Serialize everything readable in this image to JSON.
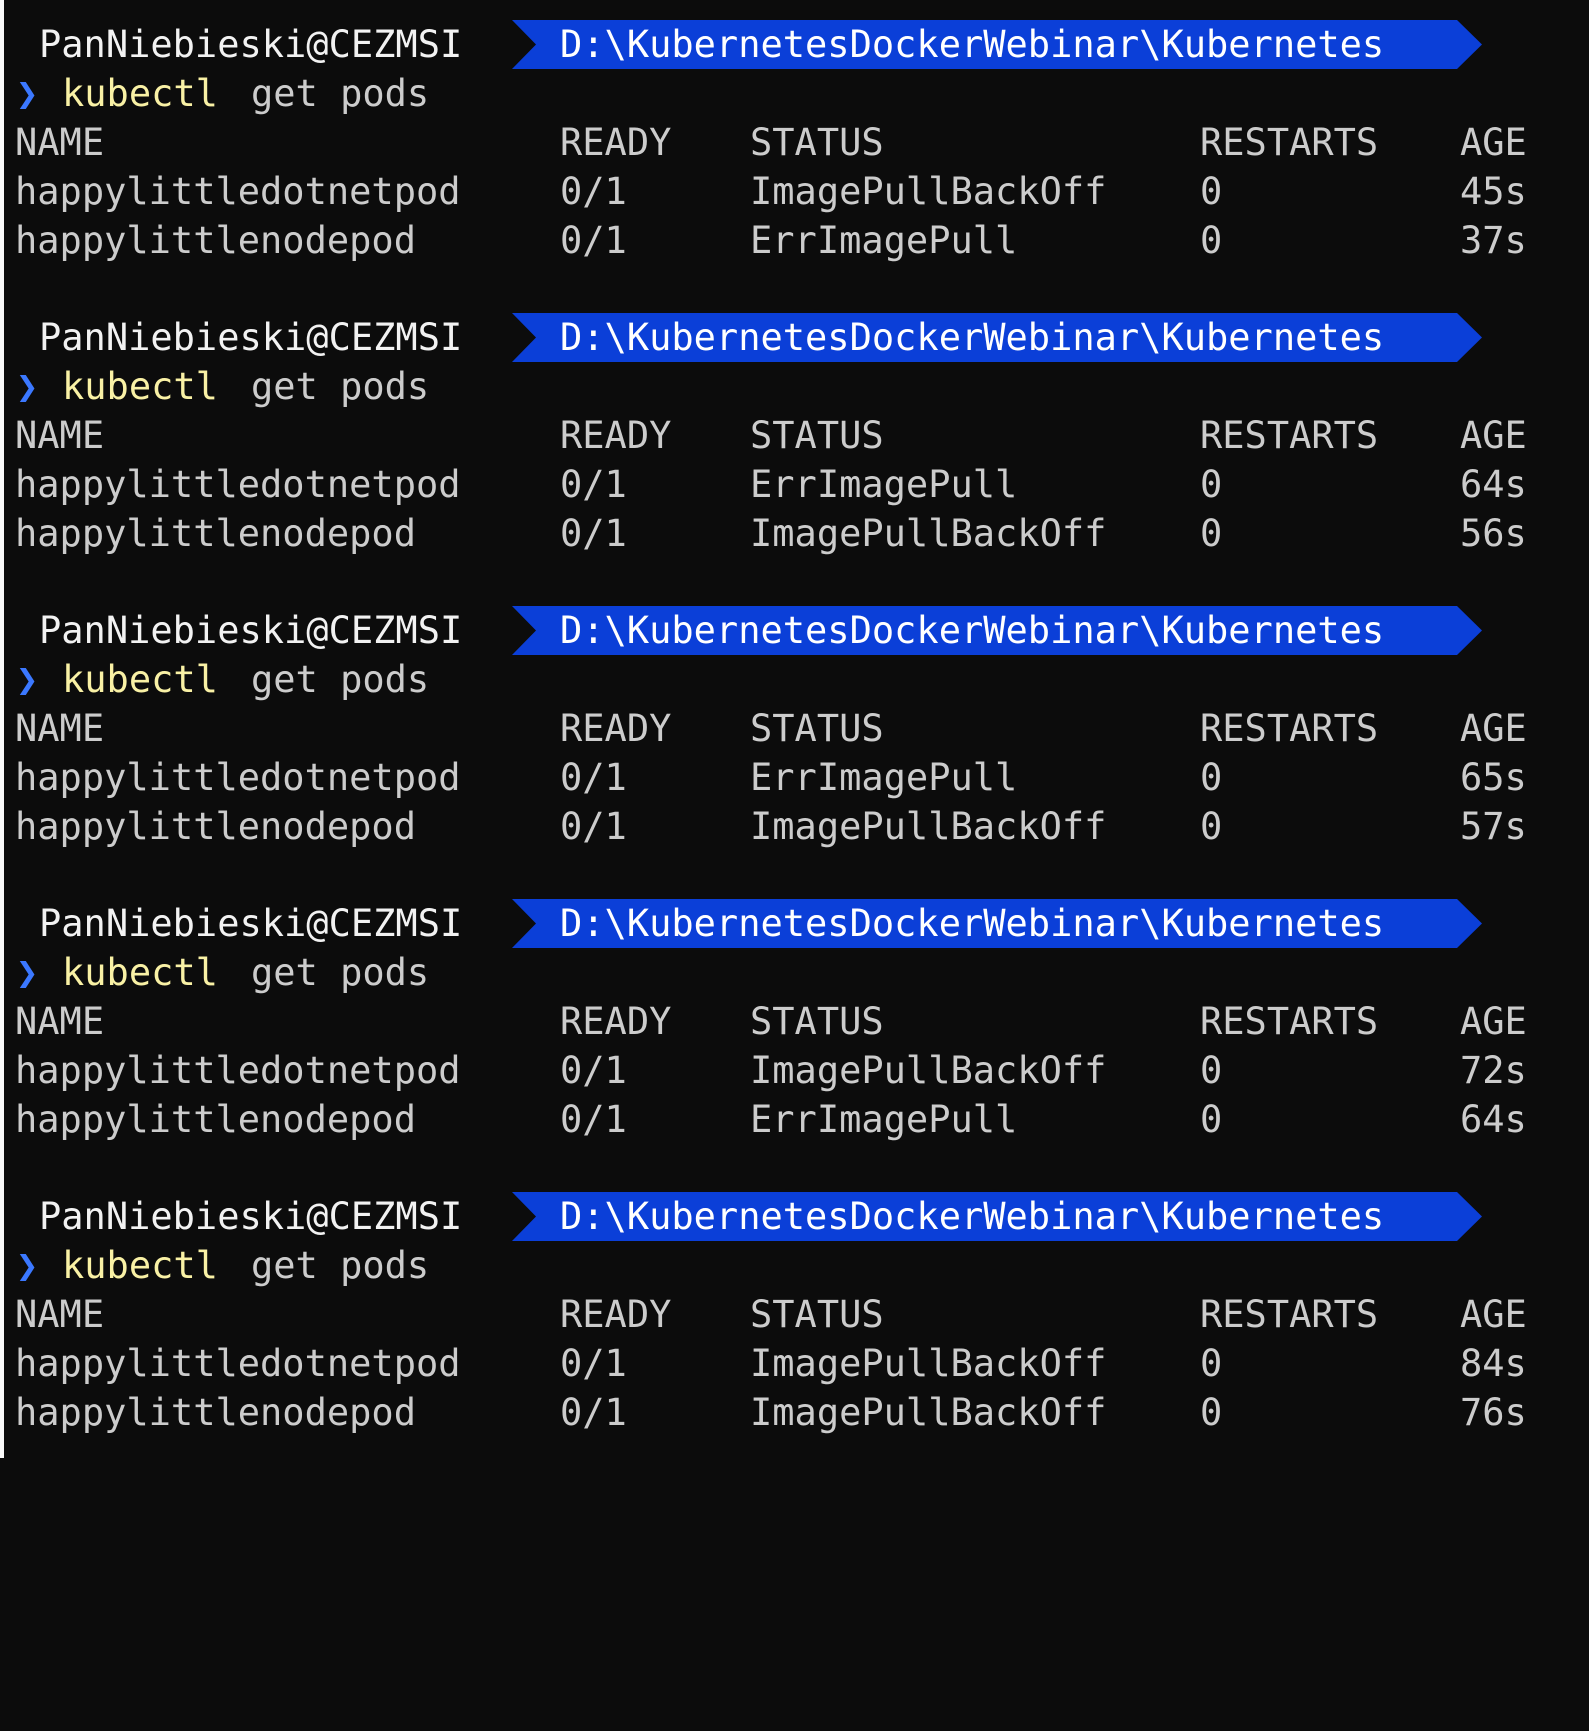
{
  "colors": {
    "background": "#0c0c0c",
    "text": "#cccccc",
    "path_segment": "#0b3fd8",
    "prompt_chevron": "#3b78ff",
    "command": "#f9f1a5"
  },
  "icons": {
    "prompt": "chevron-right-icon"
  },
  "prompt_chevron": "❯",
  "blocks": [
    {
      "user": "PanNiebieski@CEZMSI",
      "path": "D:\\KubernetesDockerWebinar\\Kubernetes",
      "command": "kubectl",
      "args": "get pods",
      "headers": [
        "NAME",
        "READY",
        "STATUS",
        "RESTARTS",
        "AGE"
      ],
      "rows": [
        [
          "happylittledotnetpod",
          "0/1",
          "ImagePullBackOff",
          "0",
          "45s"
        ],
        [
          "happylittlenodepod",
          "0/1",
          "ErrImagePull",
          "0",
          "37s"
        ]
      ]
    },
    {
      "user": "PanNiebieski@CEZMSI",
      "path": "D:\\KubernetesDockerWebinar\\Kubernetes",
      "command": "kubectl",
      "args": "get pods",
      "headers": [
        "NAME",
        "READY",
        "STATUS",
        "RESTARTS",
        "AGE"
      ],
      "rows": [
        [
          "happylittledotnetpod",
          "0/1",
          "ErrImagePull",
          "0",
          "64s"
        ],
        [
          "happylittlenodepod",
          "0/1",
          "ImagePullBackOff",
          "0",
          "56s"
        ]
      ]
    },
    {
      "user": "PanNiebieski@CEZMSI",
      "path": "D:\\KubernetesDockerWebinar\\Kubernetes",
      "command": "kubectl",
      "args": "get pods",
      "headers": [
        "NAME",
        "READY",
        "STATUS",
        "RESTARTS",
        "AGE"
      ],
      "rows": [
        [
          "happylittledotnetpod",
          "0/1",
          "ErrImagePull",
          "0",
          "65s"
        ],
        [
          "happylittlenodepod",
          "0/1",
          "ImagePullBackOff",
          "0",
          "57s"
        ]
      ]
    },
    {
      "user": "PanNiebieski@CEZMSI",
      "path": "D:\\KubernetesDockerWebinar\\Kubernetes",
      "command": "kubectl",
      "args": "get pods",
      "headers": [
        "NAME",
        "READY",
        "STATUS",
        "RESTARTS",
        "AGE"
      ],
      "rows": [
        [
          "happylittledotnetpod",
          "0/1",
          "ImagePullBackOff",
          "0",
          "72s"
        ],
        [
          "happylittlenodepod",
          "0/1",
          "ErrImagePull",
          "0",
          "64s"
        ]
      ]
    },
    {
      "user": "PanNiebieski@CEZMSI",
      "path": "D:\\KubernetesDockerWebinar\\Kubernetes",
      "command": "kubectl",
      "args": "get pods",
      "headers": [
        "NAME",
        "READY",
        "STATUS",
        "RESTARTS",
        "AGE"
      ],
      "rows": [
        [
          "happylittledotnetpod",
          "0/1",
          "ImagePullBackOff",
          "0",
          "84s"
        ],
        [
          "happylittlenodepod",
          "0/1",
          "ImagePullBackOff",
          "0",
          "76s"
        ]
      ]
    }
  ]
}
